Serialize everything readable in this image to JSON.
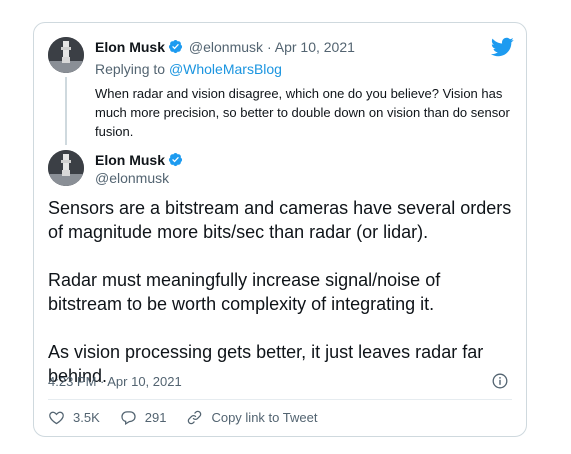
{
  "reply_tweet": {
    "author_name": "Elon Musk",
    "author_handle": "@elonmusk",
    "separator": "·",
    "date": "Apr 10, 2021",
    "replying_prefix": "Replying to",
    "replying_to": "@WholeMarsBlog",
    "text": "When radar and vision disagree, which one do you believe? Vision has much more precision, so better to double down on vision than do sensor fusion."
  },
  "main_tweet": {
    "author_name": "Elon Musk",
    "author_handle": "@elonmusk",
    "paragraphs": [
      "Sensors are a bitstream and cameras have several orders of magnitude more bits/sec than radar (or lidar).",
      "Radar must meaningfully increase signal/noise of bitstream to be worth complexity of integrating it.",
      "As vision processing gets better, it just leaves radar far behind."
    ],
    "timestamp": "4:23 PM · Apr 10, 2021"
  },
  "actions": {
    "likes": "3.5K",
    "replies": "291",
    "copy_link": "Copy link to Tweet"
  },
  "icons": {
    "brand": "twitter-bird-icon",
    "verified": "verified-badge-icon",
    "info": "info-icon",
    "like": "heart-icon",
    "reply": "comment-icon",
    "link": "link-icon"
  },
  "colors": {
    "brand_blue": "#1d9bf0",
    "mention_blue": "#1b95e0",
    "text_secondary": "#536471",
    "border": "#cfd9de"
  }
}
